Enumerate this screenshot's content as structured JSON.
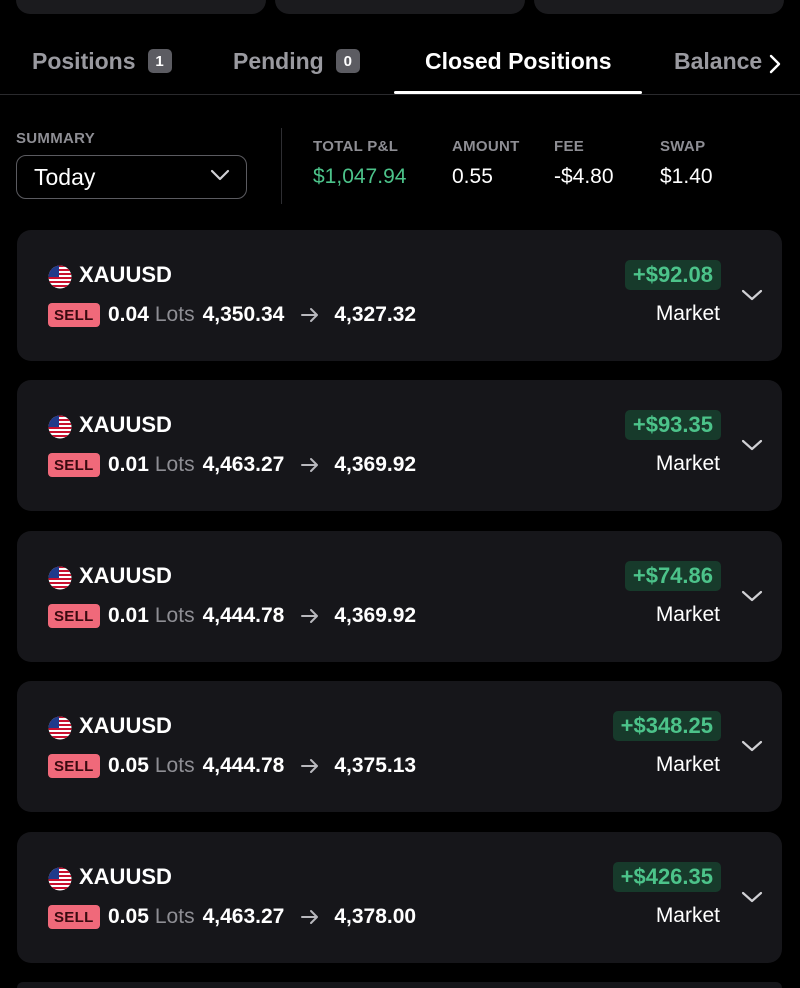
{
  "tabs": [
    {
      "label": "Positions",
      "badge": "1",
      "active": false
    },
    {
      "label": "Pending",
      "badge": "0",
      "active": false
    },
    {
      "label": "Closed Positions",
      "badge": "",
      "active": true
    },
    {
      "label": "Balance",
      "badge": "",
      "active": false
    }
  ],
  "summary": {
    "label": "SUMMARY",
    "period": "Today",
    "stats": [
      {
        "label": "TOTAL P&L",
        "value": "$1,047.94"
      },
      {
        "label": "AMOUNT",
        "value": "0.55"
      },
      {
        "label": "FEE",
        "value": "-$4.80"
      },
      {
        "label": "SWAP",
        "value": "$1.40"
      }
    ]
  },
  "positions": [
    {
      "symbol": "XAUUSD",
      "side": "SELL",
      "lots": "0.04",
      "lots_label": "Lots",
      "open_price": "4,350.34",
      "close_price": "4,327.32",
      "pnl": "+$92.08",
      "order_type": "Market"
    },
    {
      "symbol": "XAUUSD",
      "side": "SELL",
      "lots": "0.01",
      "lots_label": "Lots",
      "open_price": "4,463.27",
      "close_price": "4,369.92",
      "pnl": "+$93.35",
      "order_type": "Market"
    },
    {
      "symbol": "XAUUSD",
      "side": "SELL",
      "lots": "0.01",
      "lots_label": "Lots",
      "open_price": "4,444.78",
      "close_price": "4,369.92",
      "pnl": "+$74.86",
      "order_type": "Market"
    },
    {
      "symbol": "XAUUSD",
      "side": "SELL",
      "lots": "0.05",
      "lots_label": "Lots",
      "open_price": "4,444.78",
      "close_price": "4,375.13",
      "pnl": "+$348.25",
      "order_type": "Market"
    },
    {
      "symbol": "XAUUSD",
      "side": "SELL",
      "lots": "0.05",
      "lots_label": "Lots",
      "open_price": "4,463.27",
      "close_price": "4,378.00",
      "pnl": "+$426.35",
      "order_type": "Market"
    }
  ],
  "icons": {
    "flag": "us-flag-icon",
    "arrow": "arrow-right-icon",
    "expand": "chevron-down-icon",
    "tab_more": "chevron-right-icon"
  },
  "colors": {
    "background": "#000000",
    "card": "#16161a",
    "profit": "#4cc38a",
    "profit_bg": "#173a2b",
    "sell_badge": "#f0697a",
    "muted": "#8e8e94"
  }
}
